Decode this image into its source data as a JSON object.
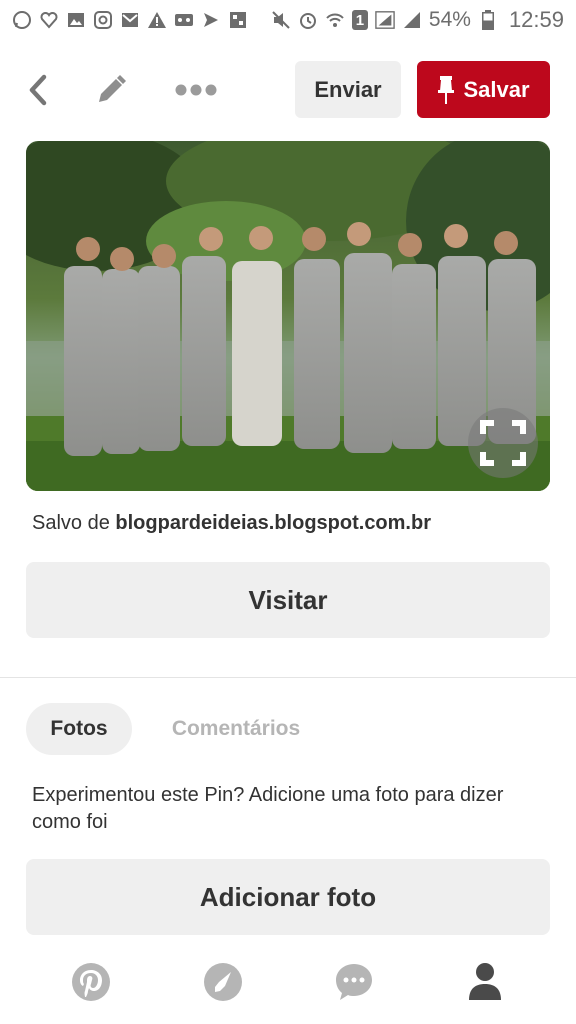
{
  "status_bar": {
    "battery_percent": "54%",
    "time": "12:59",
    "sim_label": "1",
    "icons_left": [
      "whatsapp-icon",
      "heart-icon",
      "image-icon",
      "instagram-icon",
      "gmail-icon",
      "warning-icon",
      "voicemail-icon",
      "send-icon",
      "app-icon"
    ],
    "icons_right": [
      "mute-icon",
      "alarm-icon",
      "wifi-icon",
      "sim-icon",
      "signal-icon",
      "signal-icon",
      "battery-icon"
    ]
  },
  "toolbar": {
    "send_label": "Enviar",
    "save_label": "Salvar",
    "save_color": "#bd081c"
  },
  "pin": {
    "saved_from_prefix": "Salvo de",
    "source_domain": "blogpardeideias.blogspot.com.br",
    "visit_label": "Visitar"
  },
  "tabs": {
    "photos_label": "Fotos",
    "comments_label": "Comentários"
  },
  "tried_prompt": "Experimentou este Pin? Adicione uma foto para dizer como foi",
  "add_photo_label": "Adicionar foto",
  "bottom_nav": [
    "pinterest-icon",
    "explore-icon",
    "messages-icon",
    "profile-icon"
  ]
}
